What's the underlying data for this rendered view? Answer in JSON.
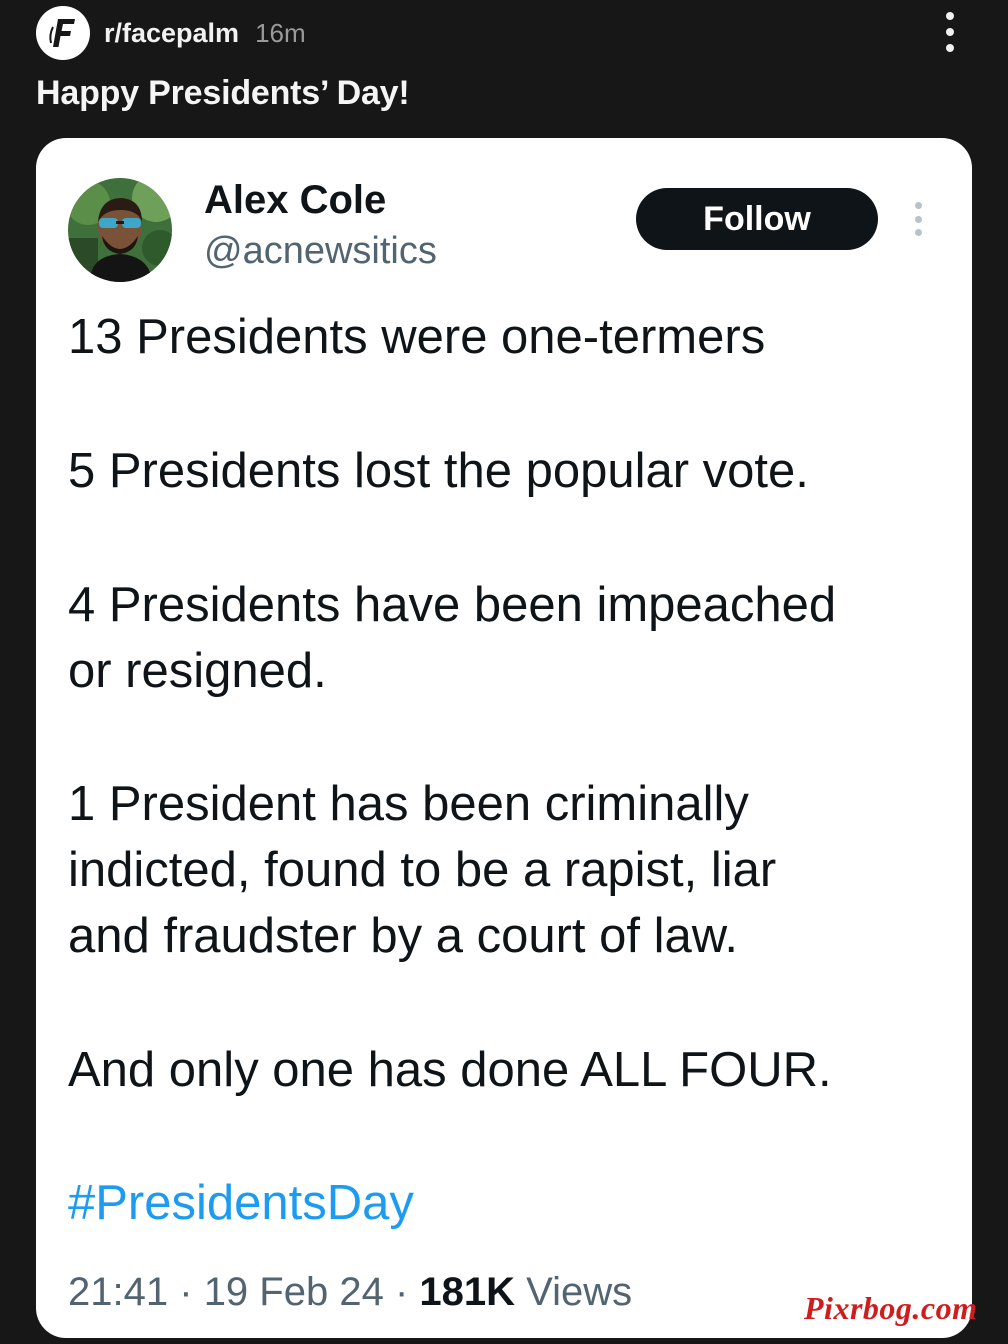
{
  "post": {
    "subreddit": "r/facepalm",
    "age": "16m",
    "title": "Happy Presidents’ Day!",
    "subreddit_icon": "facepalm-f-logo-icon",
    "menu_icon": "kebab-menu-icon"
  },
  "tweet": {
    "author_name": "Alex Cole",
    "author_handle": "@acnewsitics",
    "follow_label": "Follow",
    "paragraphs": [
      [
        "13 Presidents were one-termers"
      ],
      [
        "5 Presidents lost the popular vote."
      ],
      [
        "4 Presidents have been impeached",
        "or resigned."
      ],
      [
        "1 President has been criminally",
        "indicted, found to be a rapist, liar",
        "and fraudster by a court of law."
      ],
      [
        "And only one has done ALL FOUR."
      ]
    ],
    "hashtag": "#PresidentsDay",
    "time": "21:41",
    "date": "19 Feb 24",
    "separator": "·",
    "views_count": "181K",
    "views_label": "Views"
  },
  "watermark": "Pixrbog.com",
  "colors": {
    "background": "#171717",
    "card": "#ffffff",
    "text": "#0f1419",
    "secondary": "#536471",
    "link": "#1d9bf0",
    "follow_button": "#0f1419",
    "watermark": "#d01c1c"
  }
}
